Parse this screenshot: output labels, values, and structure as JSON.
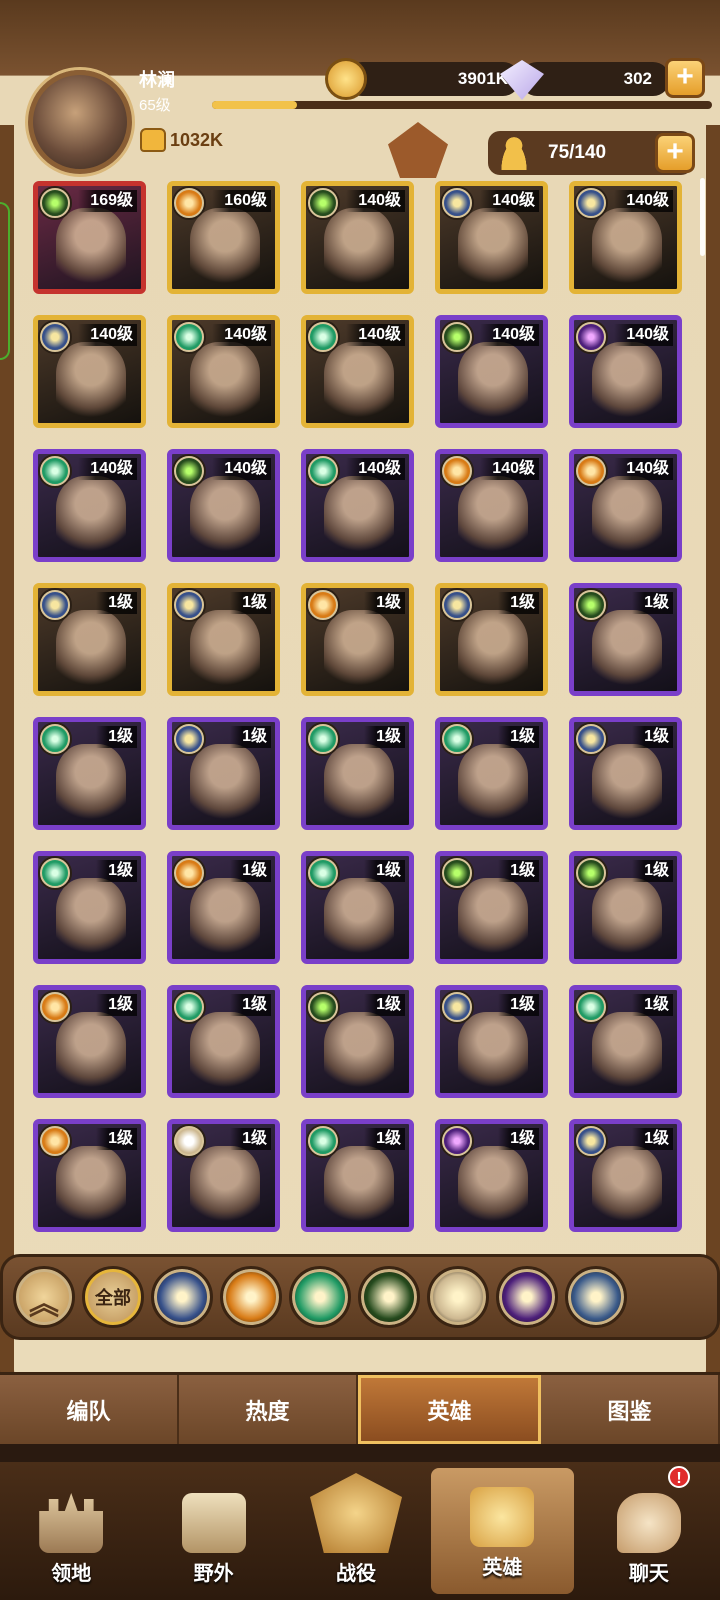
{
  "player": {
    "name": "林澜",
    "level": "65级",
    "power": "1032K",
    "xp_fraction": 0.17
  },
  "resources": {
    "gold": "3901K",
    "diamonds": "302",
    "add_label": "+"
  },
  "roster": {
    "count": "75/140",
    "add_label": "+"
  },
  "heroes": [
    {
      "level": "169级",
      "frame": "red",
      "faction": "graveborn",
      "icon": "graveborn-icon"
    },
    {
      "level": "160级",
      "frame": "gold",
      "faction": "mauler",
      "icon": "mauler-icon"
    },
    {
      "level": "140级",
      "frame": "gold",
      "faction": "graveborn",
      "icon": "graveborn-icon"
    },
    {
      "level": "140级",
      "frame": "gold",
      "faction": "lightbearer",
      "icon": "lightbearer-icon"
    },
    {
      "level": "140级",
      "frame": "gold",
      "faction": "lightbearer",
      "icon": "lightbearer-icon"
    },
    {
      "level": "140级",
      "frame": "gold",
      "faction": "lightbearer",
      "icon": "lightbearer-icon"
    },
    {
      "level": "140级",
      "frame": "gold",
      "faction": "wilder",
      "icon": "wilder-icon"
    },
    {
      "level": "140级",
      "frame": "gold",
      "faction": "wilder",
      "icon": "wilder-icon"
    },
    {
      "level": "140级",
      "frame": "purple",
      "faction": "graveborn",
      "icon": "graveborn-icon"
    },
    {
      "level": "140级",
      "frame": "purple",
      "faction": "hypogean",
      "icon": "hypogean-icon"
    },
    {
      "level": "140级",
      "frame": "purple",
      "faction": "wilder",
      "icon": "wilder-icon"
    },
    {
      "level": "140级",
      "frame": "purple",
      "faction": "graveborn",
      "icon": "graveborn-icon"
    },
    {
      "level": "140级",
      "frame": "purple",
      "faction": "wilder",
      "icon": "wilder-icon"
    },
    {
      "level": "140级",
      "frame": "purple",
      "faction": "mauler",
      "icon": "mauler-icon"
    },
    {
      "level": "140级",
      "frame": "purple",
      "faction": "mauler",
      "icon": "mauler-icon"
    },
    {
      "level": "1级",
      "frame": "gold",
      "faction": "lightbearer",
      "icon": "lightbearer-icon"
    },
    {
      "level": "1级",
      "frame": "gold",
      "faction": "lightbearer",
      "icon": "lightbearer-icon"
    },
    {
      "level": "1级",
      "frame": "gold",
      "faction": "mauler",
      "icon": "mauler-icon"
    },
    {
      "level": "1级",
      "frame": "gold",
      "faction": "lightbearer",
      "icon": "lightbearer-icon"
    },
    {
      "level": "1级",
      "frame": "purple",
      "faction": "graveborn",
      "icon": "graveborn-icon"
    },
    {
      "level": "1级",
      "frame": "purple",
      "faction": "wilder",
      "icon": "wilder-icon"
    },
    {
      "level": "1级",
      "frame": "purple",
      "faction": "lightbearer",
      "icon": "lightbearer-icon"
    },
    {
      "level": "1级",
      "frame": "purple",
      "faction": "wilder",
      "icon": "wilder-icon"
    },
    {
      "level": "1级",
      "frame": "purple",
      "faction": "wilder",
      "icon": "wilder-icon"
    },
    {
      "level": "1级",
      "frame": "purple",
      "faction": "lightbearer",
      "icon": "lightbearer-icon"
    },
    {
      "level": "1级",
      "frame": "purple",
      "faction": "wilder",
      "icon": "wilder-icon"
    },
    {
      "level": "1级",
      "frame": "purple",
      "faction": "mauler",
      "icon": "mauler-icon"
    },
    {
      "level": "1级",
      "frame": "purple",
      "faction": "wilder",
      "icon": "wilder-icon"
    },
    {
      "level": "1级",
      "frame": "purple",
      "faction": "graveborn",
      "icon": "graveborn-icon"
    },
    {
      "level": "1级",
      "frame": "purple",
      "faction": "graveborn",
      "icon": "graveborn-icon"
    },
    {
      "level": "1级",
      "frame": "purple",
      "faction": "mauler",
      "icon": "mauler-icon"
    },
    {
      "level": "1级",
      "frame": "purple",
      "faction": "wilder",
      "icon": "wilder-icon"
    },
    {
      "level": "1级",
      "frame": "purple",
      "faction": "graveborn",
      "icon": "graveborn-icon"
    },
    {
      "level": "1级",
      "frame": "purple",
      "faction": "lightbearer",
      "icon": "lightbearer-icon"
    },
    {
      "level": "1级",
      "frame": "purple",
      "faction": "wilder",
      "icon": "wilder-icon"
    },
    {
      "level": "1级",
      "frame": "purple",
      "faction": "mauler",
      "icon": "mauler-icon"
    },
    {
      "level": "1级",
      "frame": "purple",
      "faction": "celestial",
      "icon": "celestial-icon"
    },
    {
      "level": "1级",
      "frame": "purple",
      "faction": "wilder",
      "icon": "wilder-icon"
    },
    {
      "level": "1级",
      "frame": "purple",
      "faction": "hypogean",
      "icon": "hypogean-icon"
    },
    {
      "level": "1级",
      "frame": "purple",
      "faction": "lightbearer",
      "icon": "lightbearer-icon"
    }
  ],
  "filters": {
    "collapse_icon": "chevron-up-icon",
    "all_label": "全部",
    "factions": [
      {
        "icon": "lightbearer-icon",
        "color": "#36508a"
      },
      {
        "icon": "mauler-icon",
        "color": "#d87b16"
      },
      {
        "icon": "wilder-icon",
        "color": "#1f9a64"
      },
      {
        "icon": "graveborn-icon",
        "color": "#254a1d"
      },
      {
        "icon": "celestial-icon",
        "color": "#cdb891"
      },
      {
        "icon": "hypogean-icon",
        "color": "#4c1f7a"
      },
      {
        "icon": "dimensional-icon",
        "color": "#3a5a8a"
      }
    ]
  },
  "tabs": [
    {
      "label": "编队",
      "active": false
    },
    {
      "label": "热度",
      "active": false
    },
    {
      "label": "英雄",
      "active": true
    },
    {
      "label": "图鉴",
      "active": false
    }
  ],
  "bottom_nav": [
    {
      "label": "领地",
      "icon": "castle-icon",
      "active": false
    },
    {
      "label": "野外",
      "icon": "map-icon",
      "active": false
    },
    {
      "label": "战役",
      "icon": "battle-icon",
      "active": false
    },
    {
      "label": "英雄",
      "icon": "hero-helmet-icon",
      "active": true
    },
    {
      "label": "聊天",
      "icon": "chat-icon",
      "active": false,
      "badge": "!"
    }
  ],
  "colors": {
    "frame_red": "#c5332e",
    "frame_gold": "#e3b336",
    "frame_purple": "#7a3fc9",
    "accent": "#f2c24a"
  }
}
